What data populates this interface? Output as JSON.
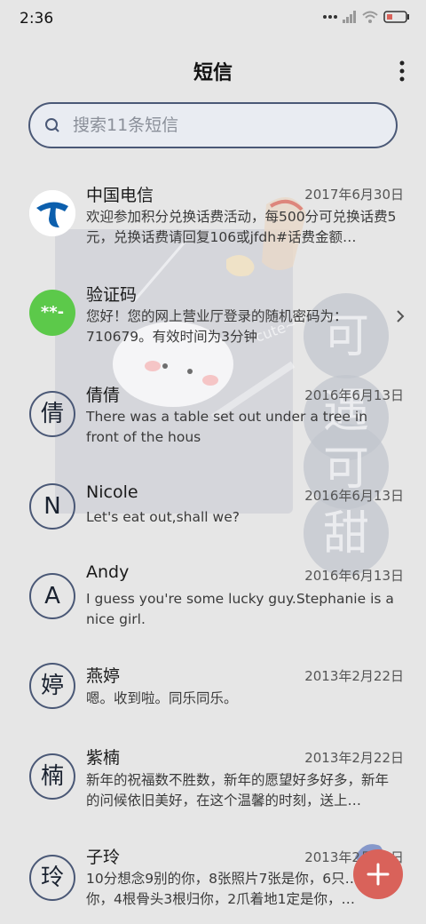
{
  "status_bar": {
    "time": "2:36"
  },
  "header": {
    "title": "短信"
  },
  "search": {
    "placeholder": "搜索11条短信"
  },
  "messages": [
    {
      "name": "中国电信",
      "date": "2017年6月30日",
      "preview": "欢迎参加积分兑换话费活动，每500分可兑换话费5元，兑换话费请回复106或jfdh#话费金额…",
      "avatar_type": "logo",
      "avatar_color": "#0c5fad"
    },
    {
      "name": "验证码",
      "date": "",
      "preview": "您好！您的网上营业厅登录的随机密码为：710679。有效时间为3分钟",
      "avatar_type": "badge",
      "avatar_text": "**-",
      "avatar_color": "#5cc94a"
    },
    {
      "name": "倩倩",
      "date": "2016年6月13日",
      "preview": "There was a table set out under a tree in front of the hous",
      "avatar_type": "letter",
      "avatar_text": "倩"
    },
    {
      "name": "Nicole",
      "date": "2016年6月13日",
      "preview": "Let's eat out,shall we?",
      "avatar_type": "letter",
      "avatar_text": "N"
    },
    {
      "name": "Andy",
      "date": "2016年6月13日",
      "preview": "I guess you're some lucky guy.Stephanie is a nice girl.",
      "avatar_type": "letter",
      "avatar_text": "A"
    },
    {
      "name": "燕婷",
      "date": "2013年2月22日",
      "preview": "嗯。收到啦。同乐同乐。",
      "avatar_type": "letter",
      "avatar_text": "婷"
    },
    {
      "name": "紫楠",
      "date": "2013年2月22日",
      "preview": "新年的祝福数不胜数，新年的愿望好多好多，新年的问候依旧美好，在这个温馨的时刻，送上…",
      "avatar_type": "letter",
      "avatar_text": "楠"
    },
    {
      "name": "子玲",
      "date": "2013年2月22日",
      "preview": "10分想念9别的你，8张照片7张是你，6只…只像你，4根骨头3根归你，2爪着地1定是你，…",
      "avatar_type": "letter",
      "avatar_text": "玲"
    }
  ],
  "wallpaper": {
    "text": [
      "可",
      "遇",
      "可",
      "甜"
    ],
    "cute_label": "cute~"
  },
  "colors": {
    "fab": "#d9625a",
    "accent": "#4a5876",
    "background": "#e6e6e6"
  },
  "icons": {
    "fab": "plus-icon",
    "chevron": "chevron-right-icon",
    "search": "search-icon",
    "menu": "more-vertical-icon"
  }
}
